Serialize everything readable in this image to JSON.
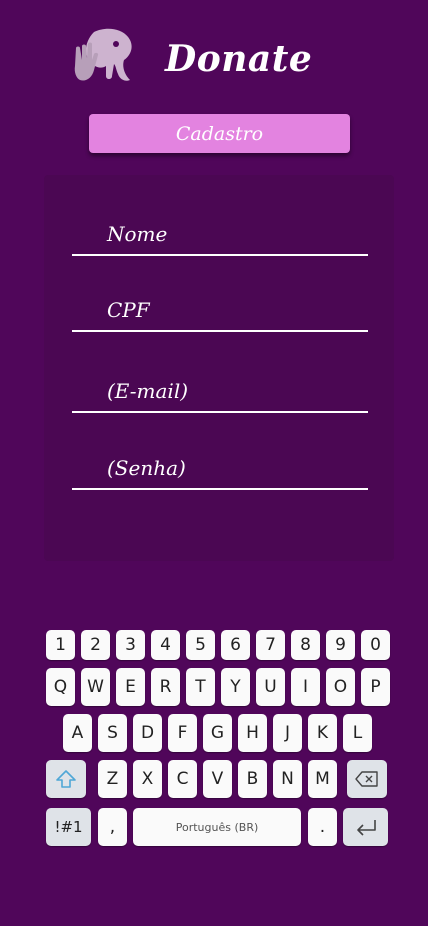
{
  "header": {
    "title": "Donate",
    "logo_icon": "hand-elephant-icon"
  },
  "buttons": {
    "cadastro": "Cadastro"
  },
  "form": {
    "fields": [
      {
        "label": "Nome"
      },
      {
        "label": "CPF"
      },
      {
        "label": "(E-mail)"
      },
      {
        "label": "(Senha)"
      }
    ]
  },
  "keyboard": {
    "rows": [
      [
        "1",
        "2",
        "3",
        "4",
        "5",
        "6",
        "7",
        "8",
        "9",
        "0"
      ],
      [
        "Q",
        "W",
        "E",
        "R",
        "T",
        "Y",
        "U",
        "I",
        "O",
        "P"
      ],
      [
        "A",
        "S",
        "D",
        "F",
        "G",
        "H",
        "J",
        "K",
        "L"
      ],
      [
        "Z",
        "X",
        "C",
        "V",
        "B",
        "N",
        "M"
      ]
    ],
    "shift_icon": "shift-arrow-icon",
    "backspace_icon": "backspace-icon",
    "symbols_label": "!#1",
    "comma_label": ",",
    "space_label": "Português (BR)",
    "period_label": ".",
    "enter_icon": "enter-icon"
  },
  "colors": {
    "background": "#50065a",
    "card": "#4b0753",
    "accent": "#e383e0",
    "key": "#fafafa",
    "special_key": "#dfe3e8"
  }
}
